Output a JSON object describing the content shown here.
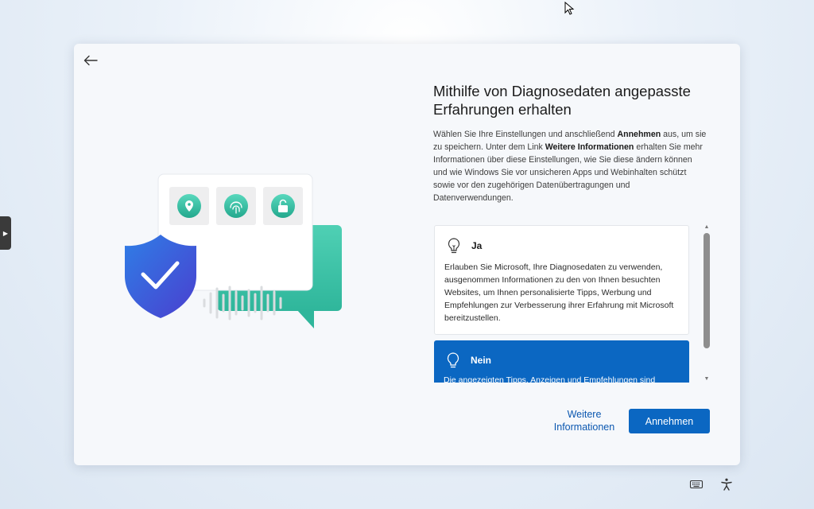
{
  "dialog": {
    "heading": "Mithilfe von Diagnosedaten angepasste Erfahrungen erhalten",
    "description": {
      "p1": "Wählen Sie Ihre Einstellungen und anschließend ",
      "b1": "Annehmen",
      "p2": " aus, um sie zu speichern. Unter dem Link ",
      "b2": "Weitere Informationen",
      "p3": " erhalten Sie mehr Informationen über diese Einstellungen, wie Sie diese ändern können und wie Windows Sie vor unsicheren Apps und Webinhalten schützt sowie vor den zugehörigen Datenübertragungen und Datenverwendungen."
    },
    "options": [
      {
        "title": "Ja",
        "text": "Erlauben Sie Microsoft, Ihre Diagnosedaten zu verwenden, ausgenommen Informationen zu den von Ihnen besuchten Websites, um Ihnen personalisierte Tipps, Werbung und Empfehlungen zur Verbesserung ihrer Erfahrung mit Microsoft bereitzustellen.",
        "selected": false
      },
      {
        "title": "Nein",
        "text": "Die angezeigten Tipps, Anzeigen und Empfehlungen sind",
        "selected": true
      }
    ],
    "more_info_label": "Weitere Informationen",
    "accept_label": "Annehmen"
  },
  "colors": {
    "accent": "#0b67c2",
    "link": "#0b57b0",
    "shield": "#3b63d8",
    "bubble": "#3fc4a8"
  },
  "icons": {
    "back": "arrow-left-icon",
    "bulb": "lightbulb-icon",
    "keyboard": "keyboard-icon",
    "accessibility": "accessibility-icon"
  }
}
